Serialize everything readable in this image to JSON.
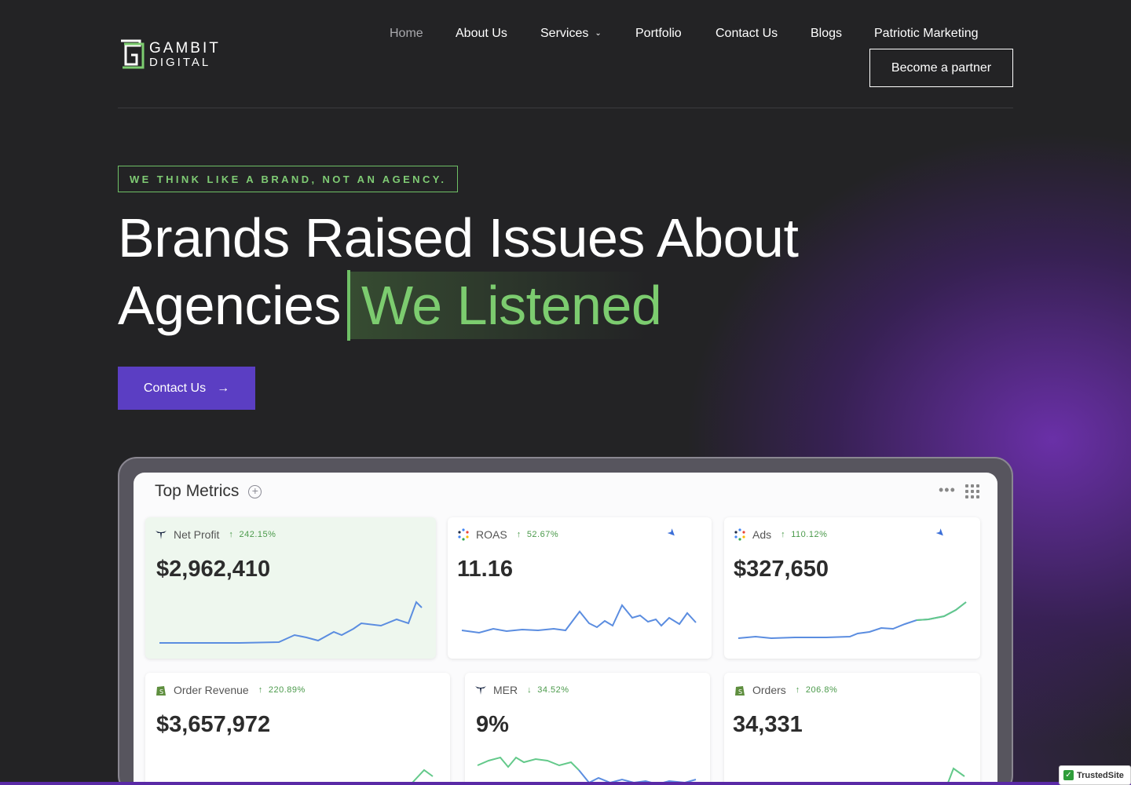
{
  "brand": {
    "line1": "GAMBIT",
    "line2": "DIGITAL",
    "accent": "#7ccc6f"
  },
  "nav": {
    "items": [
      "Home",
      "About Us",
      "Services",
      "Portfolio",
      "Contact Us",
      "Blogs",
      "Patriotic Marketing"
    ],
    "active": "Home",
    "partner_label": "Become a partner"
  },
  "hero": {
    "tagline": "WE THINK LIKE A BRAND, NOT AN AGENCY.",
    "headline_line1": "Brands Raised Issues About",
    "headline_line2": "Agencies",
    "headline_accent": "We Listened",
    "cta_label": "Contact Us",
    "cta_color": "#5b3ec3"
  },
  "dashboard": {
    "title": "Top Metrics",
    "cards": [
      {
        "label": "Net Profit",
        "delta": "242.15%",
        "direction": "up",
        "value": "$2,962,410",
        "icon": "triple-whale-icon"
      },
      {
        "label": "ROAS",
        "delta": "52.67%",
        "direction": "up",
        "value": "11.16",
        "icon": "google-dots-icon"
      },
      {
        "label": "Ads",
        "delta": "110.12%",
        "direction": "up",
        "value": "$327,650",
        "icon": "google-dots-icon"
      },
      {
        "label": "Order Revenue",
        "delta": "220.89%",
        "direction": "up",
        "value": "$3,657,972",
        "icon": "shopify-icon"
      },
      {
        "label": "MER",
        "delta": "34.52%",
        "direction": "down",
        "value": "9%",
        "icon": "triple-whale-icon"
      },
      {
        "label": "Orders",
        "delta": "206.8%",
        "direction": "up",
        "value": "34,331",
        "icon": "shopify-icon"
      }
    ]
  },
  "badge": {
    "label": "TrustedSite"
  }
}
